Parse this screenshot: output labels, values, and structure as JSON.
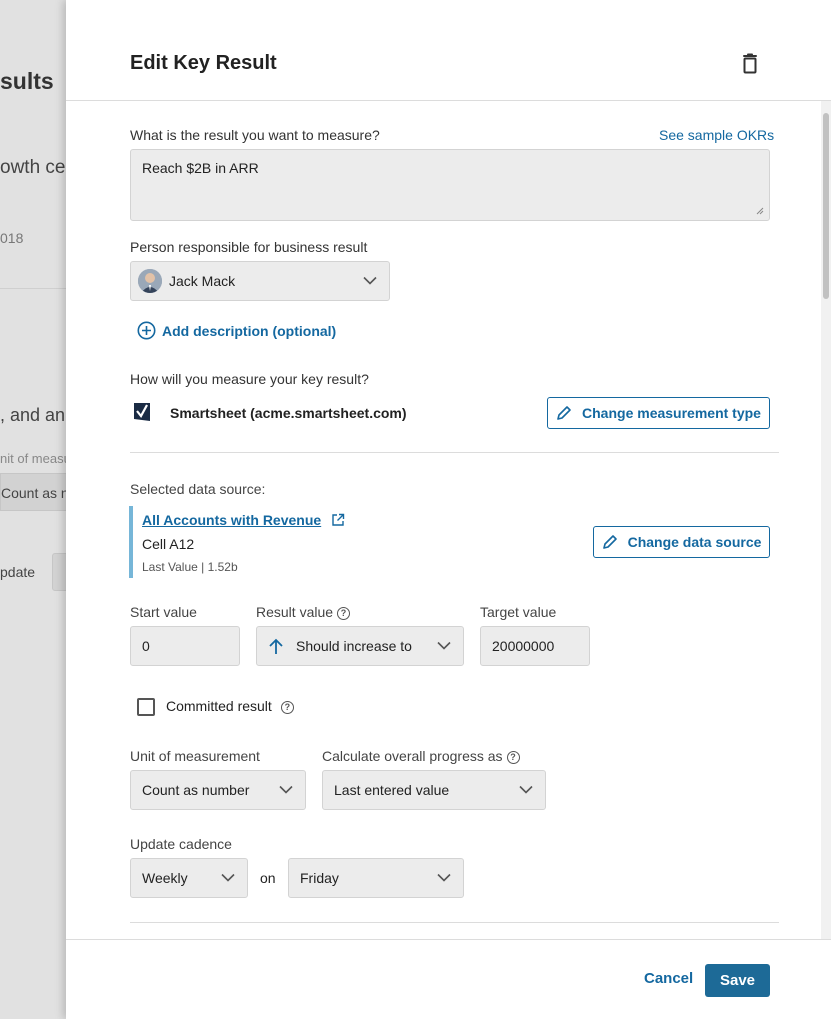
{
  "background": {
    "title_fragment": "sults",
    "subtitle_fragment": "owth ce",
    "date_fragment": "018",
    "and_fragment": ", and an",
    "unit_fragment": "nit of measu",
    "count_fragment": "Count as nu",
    "update_fragment": "pdate"
  },
  "panel": {
    "title": "Edit Key Result",
    "delete_icon": "trash-icon"
  },
  "form": {
    "result_question": "What is the result you want to measure?",
    "sample_link": "See sample OKRs",
    "result_text": "Reach $2B in ARR",
    "person_label": "Person responsible for business result",
    "person_value": "Jack Mack",
    "add_description": "Add description (optional)",
    "measure_question": "How will you measure your key result?",
    "measure_source": "Smartsheet (acme.smartsheet.com)",
    "change_measurement": "Change measurement type",
    "data_source_label": "Selected data source:",
    "data_source_name": "All Accounts with Revenue",
    "data_source_cell": "Cell A12",
    "last_value": "Last Value |  1.52b",
    "change_data_source": "Change data source",
    "start_label": "Start value",
    "start_value": "0",
    "result_label": "Result value",
    "result_value": "Should increase to",
    "target_label": "Target value",
    "target_value": "20000000",
    "committed_label": "Committed result",
    "committed_checked": false,
    "unit_label": "Unit of measurement",
    "unit_value": "Count as number",
    "progress_label": "Calculate overall progress as",
    "progress_value": "Last entered value",
    "cadence_label": "Update cadence",
    "cadence_value": "Weekly",
    "on_label": "on",
    "day_value": "Friday"
  },
  "footer": {
    "cancel": "Cancel",
    "save": "Save"
  },
  "colors": {
    "accent": "#1468a0",
    "save_button": "#1d6a97",
    "source_bar": "#76b6d8"
  }
}
